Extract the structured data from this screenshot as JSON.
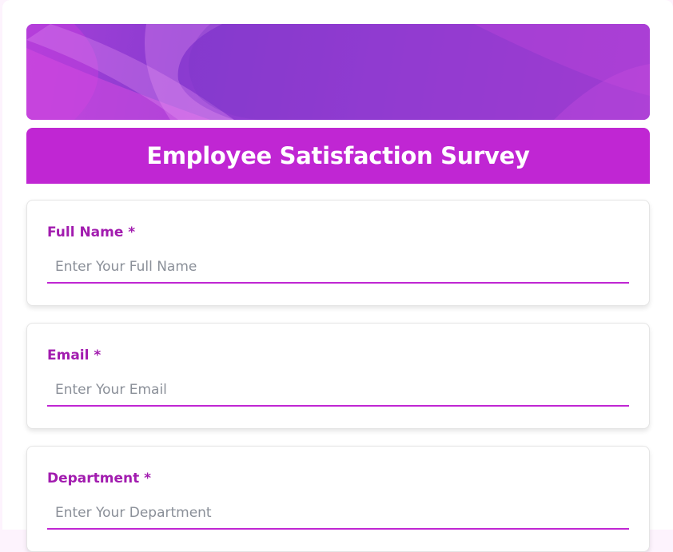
{
  "survey": {
    "title": "Employee Satisfaction Survey"
  },
  "fields": [
    {
      "label": "Full Name *",
      "placeholder": "Enter Your Full Name",
      "value": ""
    },
    {
      "label": "Email *",
      "placeholder": "Enter Your Email",
      "value": ""
    },
    {
      "label": "Department *",
      "placeholder": "Enter Your Department",
      "value": ""
    }
  ],
  "colors": {
    "accent": "#c026d3",
    "label": "#a21caf",
    "banner": "#8a3bd0"
  }
}
